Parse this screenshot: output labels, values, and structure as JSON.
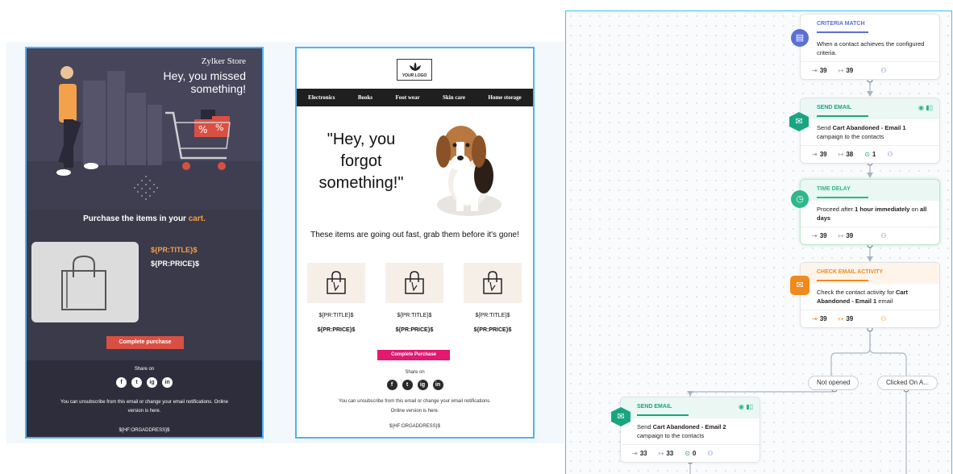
{
  "template_dark": {
    "store_name": "Zylker Store",
    "headline": "Hey, you missed something!",
    "purchase_prefix": "Purchase the items in your ",
    "purchase_accent": "cart.",
    "title_token": "${PR:TITLE}$",
    "price_token": "${PR:PRICE}$",
    "button_label": "Complete purchase",
    "share_label": "Share on",
    "social": [
      "f",
      "t",
      "ig",
      "in"
    ],
    "unsubscribe_text": "You can unsubscribe from this email or change your email notifications. Online version is here.",
    "address_token": "${HF:ORGADDRESS}$",
    "colors": {
      "background": "#3b3a4a",
      "accent": "#f3a14a",
      "button": "#d95042"
    }
  },
  "template_light": {
    "logo_text": "YOUR LOGO",
    "nav": [
      "Electronics",
      "Books",
      "Foot wear",
      "Skin care",
      "Home storage"
    ],
    "quote": "\"Hey, you forgot something!\"",
    "subheading": "These items are going out fast, grab them before it's gone!",
    "products": [
      {
        "title": "${PR:TITLE}$",
        "price": "${PR:PRICE}$"
      },
      {
        "title": "${PR:TITLE}$",
        "price": "${PR:PRICE}$"
      },
      {
        "title": "${PR:TITLE}$",
        "price": "${PR:PRICE}$"
      }
    ],
    "button_label": "Complete Purchase",
    "share_label": "Share on",
    "social": [
      "f",
      "t",
      "ig",
      "in"
    ],
    "unsubscribe_text": "You can unsubscribe from this email or change your email notifications. Online version is here.",
    "address_token": "${HF:ORGADDRESS}$",
    "colors": {
      "button": "#e3196f",
      "nav": "#1f1f1f"
    }
  },
  "workflow": {
    "nodes": [
      {
        "type": "CRITERIA MATCH",
        "icon": "criteria-icon",
        "color": "#5b6fd8",
        "body": "When a contact achieves the configured criteria.",
        "stats": {
          "in": "39",
          "out": "39"
        }
      },
      {
        "type": "SEND EMAIL",
        "icon": "envelope-icon",
        "color": "#1aa582",
        "body_prefix": "Send ",
        "body_bold": "Cart Abandoned - Email 1",
        "body_suffix": " campaign to the contacts",
        "stats": {
          "in": "39",
          "out": "38",
          "goal": "1"
        }
      },
      {
        "type": "TIME DELAY",
        "icon": "clock-icon",
        "color": "#2eb88a",
        "body_prefix": "Proceed after ",
        "body_bold": "1 hour immediately",
        "body_mid": " on ",
        "body_bold2": "all days",
        "stats": {
          "in": "39",
          "out": "39"
        }
      },
      {
        "type": "CHECK EMAIL ACTIVITY",
        "icon": "email-activity-icon",
        "color": "#f08a1c",
        "body_prefix": "Check the contact activity for ",
        "body_bold": "Cart Abandoned - Email 1",
        "body_suffix": " email",
        "stats": {
          "in": "39",
          "out": "39"
        }
      },
      {
        "type": "SEND EMAIL",
        "icon": "envelope-icon",
        "color": "#1aa582",
        "body_prefix": "Send ",
        "body_bold": "Cart Abandoned - Email 2",
        "body_suffix": " campaign to the contacts",
        "stats": {
          "in": "33",
          "out": "33",
          "goal": "0"
        }
      }
    ],
    "branches": [
      "Not opened",
      "Clicked On A..."
    ]
  }
}
